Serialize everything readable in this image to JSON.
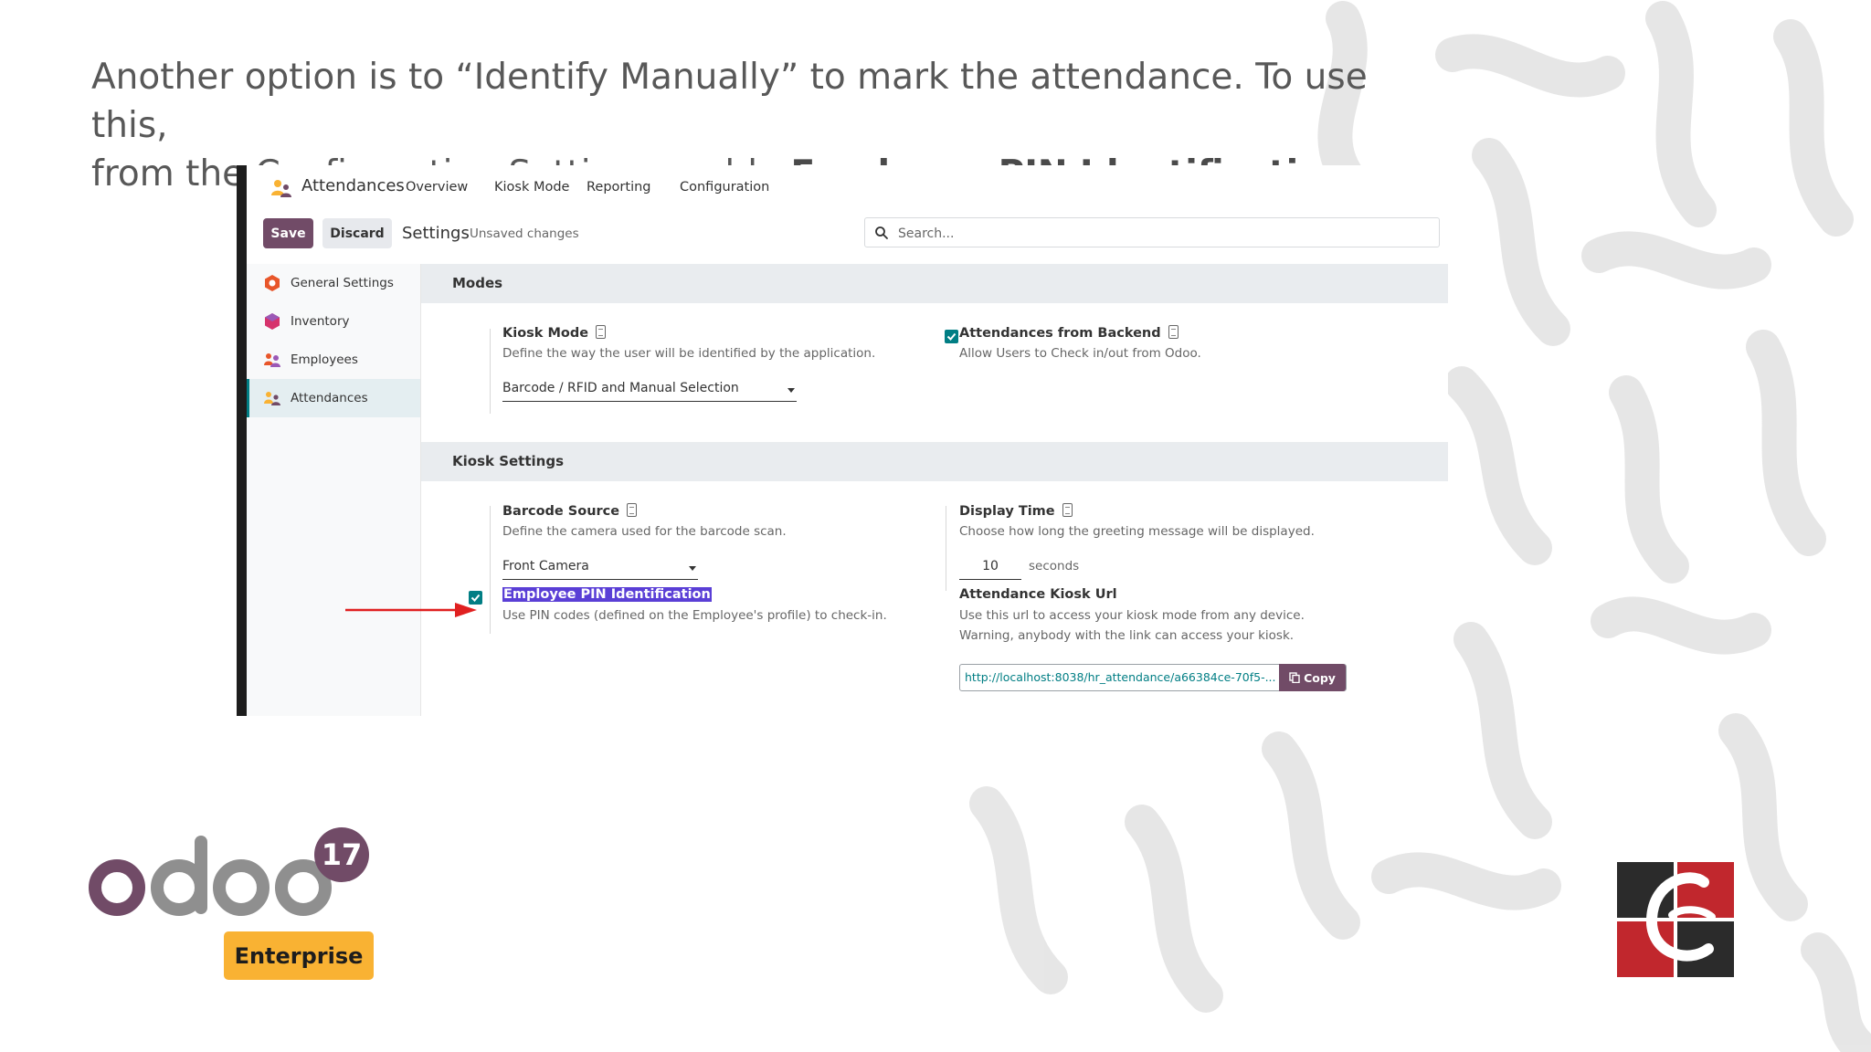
{
  "slide": {
    "heading_line1": "Another option is to “Identify Manually” to mark the attendance. To use this,",
    "heading_line2_prefix": "from the Configuration Setting, enable ",
    "heading_line2_bold": "Employee PIN Identification"
  },
  "navbar": {
    "app_name": "Attendances",
    "menu": [
      "Overview",
      "Kiosk Mode",
      "Reporting",
      "Configuration"
    ]
  },
  "control_panel": {
    "save_label": "Save",
    "discard_label": "Discard",
    "title": "Settings",
    "status": "Unsaved changes",
    "search_placeholder": "Search..."
  },
  "sidebar": {
    "items": [
      {
        "label": "General Settings",
        "icon": "general-settings-icon",
        "active": false
      },
      {
        "label": "Inventory",
        "icon": "inventory-icon",
        "active": false
      },
      {
        "label": "Employees",
        "icon": "employees-icon",
        "active": false
      },
      {
        "label": "Attendances",
        "icon": "attendances-icon",
        "active": true
      }
    ]
  },
  "sections": {
    "modes": {
      "title": "Modes",
      "kiosk_mode": {
        "title": "Kiosk Mode",
        "desc": "Define the way the user will be identified by the application.",
        "value": "Barcode / RFID and Manual Selection"
      },
      "backend": {
        "title": "Attendances from Backend",
        "desc": "Allow Users to Check in/out from Odoo.",
        "checked": true
      }
    },
    "kiosk": {
      "title": "Kiosk Settings",
      "barcode_source": {
        "title": "Barcode Source",
        "desc": "Define the camera used for the barcode scan.",
        "value": "Front Camera"
      },
      "display_time": {
        "title": "Display Time",
        "desc": "Choose how long the greeting message will be displayed.",
        "value": "10",
        "unit": "seconds"
      },
      "pin": {
        "title": "Employee PIN Identification",
        "desc": "Use PIN codes (defined on the Employee's profile) to check-in.",
        "checked": true
      },
      "kiosk_url": {
        "title": "Attendance Kiosk Url",
        "desc_line1": "Use this url to access your kiosk mode from any device.",
        "desc_line2": "Warning, anybody with the link can access your kiosk.",
        "url": "http://localhost:8038/hr_attendance/a66384ce-70f5-...",
        "copy_label": "Copy"
      }
    }
  },
  "branding": {
    "odoo_version": "17",
    "edition": "Enterprise"
  },
  "colors": {
    "primary": "#714b67",
    "accent": "#017e84",
    "enterprise": "#f9b233",
    "highlight": "#5a3fd6",
    "arrow": "#e02020"
  }
}
